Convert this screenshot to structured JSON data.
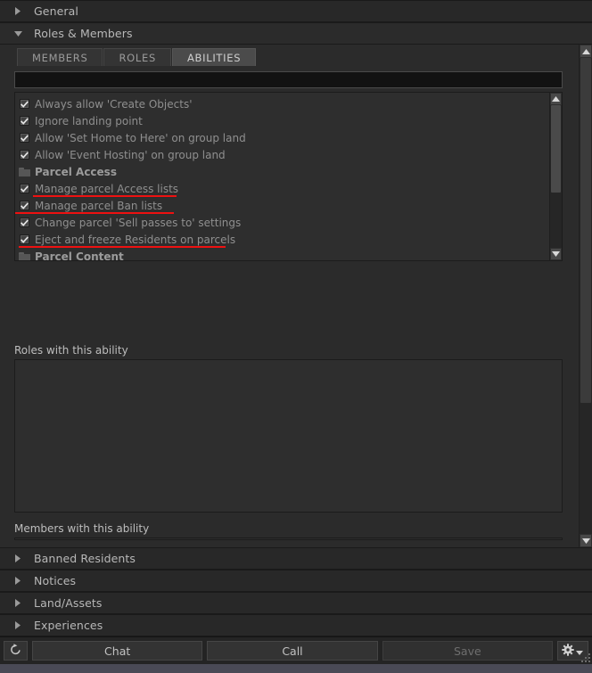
{
  "accordion": {
    "top": [
      {
        "label": "General",
        "expanded": false,
        "icon": "chevron-right-icon"
      },
      {
        "label": "Roles & Members",
        "expanded": true,
        "icon": "chevron-down-icon"
      }
    ],
    "bottom": [
      {
        "label": "Banned Residents",
        "expanded": false,
        "icon": "chevron-right-icon"
      },
      {
        "label": "Notices",
        "expanded": false,
        "icon": "chevron-right-icon"
      },
      {
        "label": "Land/Assets",
        "expanded": false,
        "icon": "chevron-right-icon"
      },
      {
        "label": "Experiences",
        "expanded": false,
        "icon": "chevron-right-icon"
      }
    ]
  },
  "tabs": [
    {
      "label": "MEMBERS",
      "active": false
    },
    {
      "label": "ROLES",
      "active": false
    },
    {
      "label": "ABILITIES",
      "active": true
    }
  ],
  "search": {
    "value": "",
    "placeholder": ""
  },
  "abilities": [
    {
      "label": "Always allow 'Create Objects'",
      "type": "checkbox",
      "checked": true,
      "annotated": false
    },
    {
      "label": "Ignore landing point",
      "type": "checkbox",
      "checked": true,
      "annotated": false
    },
    {
      "label": "Allow 'Set Home to Here' on group land",
      "type": "checkbox",
      "checked": true,
      "annotated": false
    },
    {
      "label": "Allow 'Event Hosting' on group land",
      "type": "checkbox",
      "checked": true,
      "annotated": false
    },
    {
      "label": "Parcel Access",
      "type": "folder",
      "checked": false,
      "annotated": false
    },
    {
      "label": "Manage parcel Access lists",
      "type": "checkbox",
      "checked": true,
      "annotated": true
    },
    {
      "label": "Manage parcel Ban lists",
      "type": "checkbox",
      "checked": true,
      "annotated": true
    },
    {
      "label": "Change parcel 'Sell passes to' settings",
      "type": "checkbox",
      "checked": true,
      "annotated": false
    },
    {
      "label": "Eject and freeze Residents on parcels",
      "type": "checkbox",
      "checked": true,
      "annotated": true
    },
    {
      "label": "Parcel Content",
      "type": "folder",
      "checked": false,
      "annotated": false
    }
  ],
  "sections": {
    "roles_label": "Roles with this ability",
    "members_label": "Members with this ability"
  },
  "toolbar": {
    "refresh_label": "",
    "chat_label": "Chat",
    "call_label": "Call",
    "save_label": "Save",
    "gear_label": ""
  },
  "colors": {
    "annotation": "#ee1111",
    "panel": "#2b2b2b",
    "list_bg": "#2e2e2e",
    "tab_active": "#4b4b4b",
    "text": "#8f8f8f"
  }
}
